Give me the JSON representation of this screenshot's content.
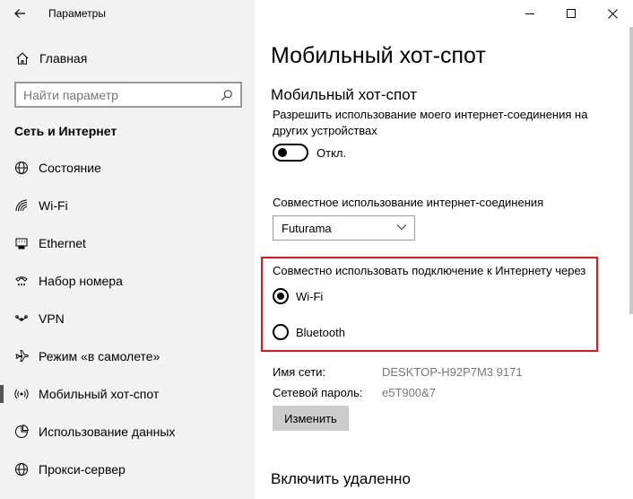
{
  "window": {
    "title": "Параметры"
  },
  "sidebar": {
    "home_label": "Главная",
    "search_placeholder": "Найти параметр",
    "section_title": "Сеть и Интернет",
    "items": [
      {
        "label": "Состояние",
        "icon": "globe-icon"
      },
      {
        "label": "Wi-Fi",
        "icon": "wifi-icon"
      },
      {
        "label": "Ethernet",
        "icon": "ethernet-icon"
      },
      {
        "label": "Набор номера",
        "icon": "dialup-icon"
      },
      {
        "label": "VPN",
        "icon": "vpn-icon"
      },
      {
        "label": "Режим «в самолете»",
        "icon": "airplane-icon"
      },
      {
        "label": "Мобильный хот-спот",
        "icon": "hotspot-icon",
        "active": true
      },
      {
        "label": "Использование данных",
        "icon": "data-usage-icon"
      },
      {
        "label": "Прокси-сервер",
        "icon": "globe-icon"
      }
    ]
  },
  "main": {
    "page_title": "Мобильный хот-спот",
    "section_title": "Мобильный хот-спот",
    "allow_text": "Разрешить использование моего интернет-соединения на других устройствах",
    "toggle_state": "Откл.",
    "share_label": "Совместное использование интернет-соединения",
    "share_selected": "Futurama",
    "share_via_label": "Совместно использовать подключение к Интернету через",
    "radio_options": [
      {
        "label": "Wi-Fi",
        "checked": true
      },
      {
        "label": "Bluetooth",
        "checked": false
      }
    ],
    "network_name_label": "Имя сети:",
    "network_name_value": "DESKTOP-H92P7M3 9171",
    "password_label": "Сетевой пароль:",
    "password_value": "e5T900&7",
    "change_button": "Изменить",
    "remote_title": "Включить удаленно"
  },
  "colors": {
    "sidebar_bg": "#f2f2f2",
    "highlight_border": "#e5131d",
    "button_bg": "#cccccc"
  }
}
